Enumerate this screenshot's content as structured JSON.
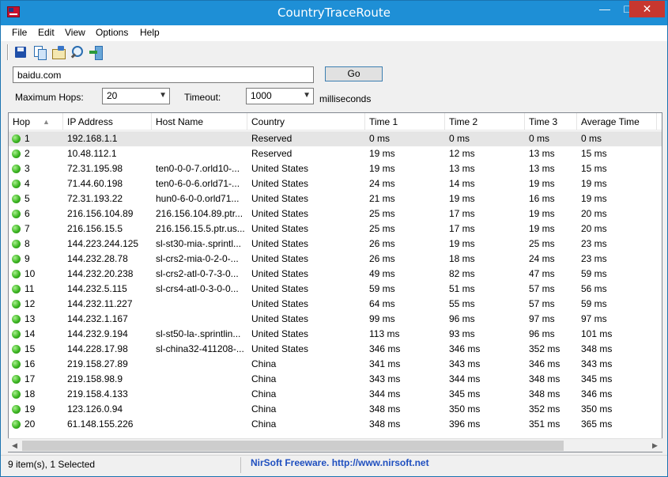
{
  "window": {
    "title": "CountryTraceRoute"
  },
  "menu": [
    "File",
    "Edit",
    "View",
    "Options",
    "Help"
  ],
  "toolbar": {
    "icons": [
      "save-icon",
      "copy-icon",
      "properties-icon",
      "find-icon",
      "exit-icon"
    ]
  },
  "form": {
    "host_value": "baidu.com",
    "go_label": "Go",
    "max_hops_label": "Maximum Hops:",
    "max_hops_value": "20",
    "timeout_label": "Timeout:",
    "timeout_value": "1000",
    "timeout_unit": "milliseconds"
  },
  "columns": [
    "Hop",
    "IP Address",
    "Host Name",
    "Country",
    "Time 1",
    "Time 2",
    "Time 3",
    "Average Time"
  ],
  "rows": [
    [
      "1",
      "192.168.1.1",
      "",
      "Reserved",
      "0 ms",
      "0 ms",
      "0 ms",
      "0 ms"
    ],
    [
      "2",
      "10.48.112.1",
      "",
      "Reserved",
      "19 ms",
      "12 ms",
      "13 ms",
      "15 ms"
    ],
    [
      "3",
      "72.31.195.98",
      "ten0-0-0-7.orld10-...",
      "United States",
      "19 ms",
      "13 ms",
      "13 ms",
      "15 ms"
    ],
    [
      "4",
      "71.44.60.198",
      "ten0-6-0-6.orld71-...",
      "United States",
      "24 ms",
      "14 ms",
      "19 ms",
      "19 ms"
    ],
    [
      "5",
      "72.31.193.22",
      "hun0-6-0-0.orld71...",
      "United States",
      "21 ms",
      "19 ms",
      "16 ms",
      "19 ms"
    ],
    [
      "6",
      "216.156.104.89",
      "216.156.104.89.ptr...",
      "United States",
      "25 ms",
      "17 ms",
      "19 ms",
      "20 ms"
    ],
    [
      "7",
      "216.156.15.5",
      "216.156.15.5.ptr.us...",
      "United States",
      "25 ms",
      "17 ms",
      "19 ms",
      "20 ms"
    ],
    [
      "8",
      "144.223.244.125",
      "sl-st30-mia-.sprintl...",
      "United States",
      "26 ms",
      "19 ms",
      "25 ms",
      "23 ms"
    ],
    [
      "9",
      "144.232.28.78",
      "sl-crs2-mia-0-2-0-...",
      "United States",
      "26 ms",
      "18 ms",
      "24 ms",
      "23 ms"
    ],
    [
      "10",
      "144.232.20.238",
      "sl-crs2-atl-0-7-3-0...",
      "United States",
      "49 ms",
      "82 ms",
      "47 ms",
      "59 ms"
    ],
    [
      "11",
      "144.232.5.115",
      "sl-crs4-atl-0-3-0-0...",
      "United States",
      "59 ms",
      "51 ms",
      "57 ms",
      "56 ms"
    ],
    [
      "12",
      "144.232.11.227",
      "",
      "United States",
      "64 ms",
      "55 ms",
      "57 ms",
      "59 ms"
    ],
    [
      "13",
      "144.232.1.167",
      "",
      "United States",
      "99 ms",
      "96 ms",
      "97 ms",
      "97 ms"
    ],
    [
      "14",
      "144.232.9.194",
      "sl-st50-la-.sprintlin...",
      "United States",
      "113 ms",
      "93 ms",
      "96 ms",
      "101 ms"
    ],
    [
      "15",
      "144.228.17.98",
      "sl-china32-411208-...",
      "United States",
      "346 ms",
      "346 ms",
      "352 ms",
      "348 ms"
    ],
    [
      "16",
      "219.158.27.89",
      "",
      "China",
      "341 ms",
      "343 ms",
      "346 ms",
      "343 ms"
    ],
    [
      "17",
      "219.158.98.9",
      "",
      "China",
      "343 ms",
      "344 ms",
      "348 ms",
      "345 ms"
    ],
    [
      "18",
      "219.158.4.133",
      "",
      "China",
      "344 ms",
      "345 ms",
      "348 ms",
      "346 ms"
    ],
    [
      "19",
      "123.126.0.94",
      "",
      "China",
      "348 ms",
      "350 ms",
      "352 ms",
      "350 ms"
    ],
    [
      "20",
      "61.148.155.226",
      "",
      "China",
      "348 ms",
      "396 ms",
      "351 ms",
      "365 ms"
    ]
  ],
  "status": {
    "left": "9 item(s), 1 Selected",
    "right": "NirSoft Freeware.  http://www.nirsoft.net"
  },
  "colors": {
    "titlebar": "#1e8fd6",
    "close": "#c7372f",
    "status_link": "#1f4fbf",
    "hop_ok": "#3bb521"
  }
}
